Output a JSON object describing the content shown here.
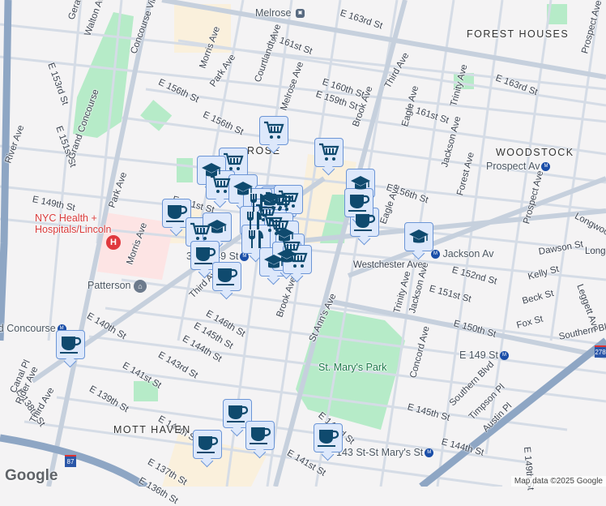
{
  "map": {
    "neighborhoods": [
      "FOREST HOUSES",
      "WOODSTOCK",
      "MOTT HAVEN",
      "ROSE"
    ],
    "pois": {
      "hospital": "NYC Health + Hospitals/Lincoln",
      "library": "Patterson",
      "park": "St. Mary's Park"
    },
    "stations": [
      "Melrose",
      "Prospect Av",
      "Jackson Av",
      "E 149 St",
      "143 St-St Mary's St",
      "3 Av-149 St",
      "Grand Concourse"
    ],
    "streets": [
      "E 163rd St",
      "E 161st St",
      "E 163rd St",
      "E 160th St",
      "E 159th St",
      "E 161st St",
      "E 156th St",
      "E 156th St",
      "E 156th St",
      "E 153rd St",
      "E 151st St",
      "E 149th St",
      "E 151st St",
      "Gerard Ave",
      "Walton Ave",
      "River Ave",
      "Concourse Village W",
      "Grand Concourse",
      "Morris Ave",
      "Park Ave",
      "Park Ave",
      "Morris Ave",
      "Courtlandt Ave",
      "Melrose Ave",
      "Third Ave",
      "Brook Ave",
      "Eagle Ave",
      "Eagle Ave",
      "Trinity Ave",
      "Jackson Ave",
      "Forest Ave",
      "Prospect Ave",
      "Prospect Ave",
      "Longwood",
      "Westchester Ave",
      "E 152nd St",
      "E 151st St",
      "E 150th St",
      "Dawson St",
      "Kelly St",
      "Beck St",
      "Fox St",
      "Leggett Ave",
      "Southern Blvd",
      "Southern Blvd",
      "Timpson Pl",
      "Austin Pl",
      "E 145th St",
      "E 144th St",
      "E 149th St",
      "Trinity Ave",
      "Jackson Ave",
      "Concord Ave",
      "St Ann's Ave",
      "Brook Ave",
      "E 146th St",
      "E 145th St",
      "E 144th St",
      "E 143rd St",
      "E 141st St",
      "E 140th St",
      "E 139th St",
      "E 138th St",
      "E 140th St",
      "Canal Pl",
      "Rider Ave",
      "Third Ave",
      "Third Ave",
      "E 137th St",
      "E 136th St",
      "E 141st St",
      "E 143rd St",
      "Long"
    ],
    "markers": [
      "grocery",
      "grocery",
      "grocery",
      "school",
      "grocery",
      "school",
      "school",
      "grocery",
      "grocery",
      "grocery",
      "restaurant",
      "grocery",
      "restaurant",
      "grocery",
      "grocery",
      "coffee",
      "grocery",
      "school",
      "restaurant",
      "school",
      "grocery",
      "coffee",
      "coffee",
      "school",
      "school",
      "grocery",
      "coffee",
      "school",
      "school",
      "coffee",
      "coffee",
      "coffee",
      "coffee",
      "coffee",
      "coffee"
    ],
    "attribution": "Map data ©2025 Google",
    "logo": "Google",
    "highway_shield": "87",
    "highway_shield_2": "278"
  },
  "colors": {
    "marker_fill": "#dde8fb",
    "marker_border": "#6b95d6",
    "icon": "#0f4a6e",
    "park": "#b6ebc8",
    "road": "#d5dce6",
    "highway": "#8ea6c4"
  }
}
